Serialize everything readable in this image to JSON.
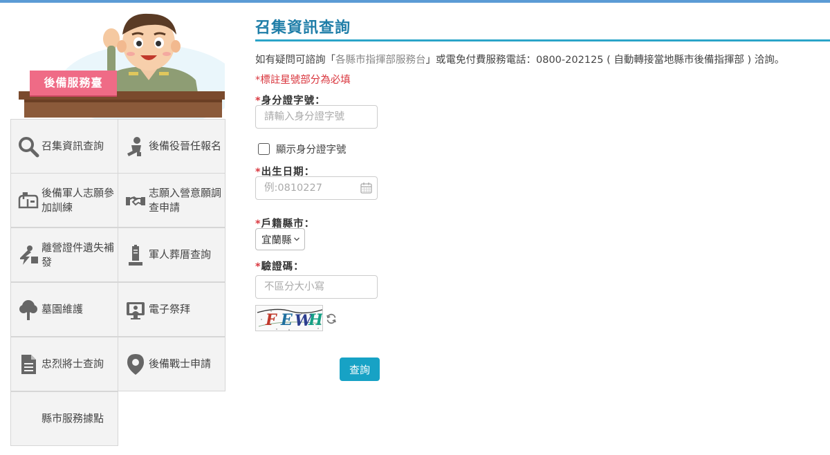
{
  "header": {
    "accent_color": "#5b9bd5"
  },
  "sidebar": {
    "sign_text": "後備服務臺",
    "items": [
      {
        "label": "召集資訊查詢",
        "icon": "search-icon"
      },
      {
        "label": "後備役晉任報名",
        "icon": "soldier-icon"
      },
      {
        "label": "後備軍人志願參加訓練",
        "icon": "mailbox-icon"
      },
      {
        "label": "志願入營意願調查申請",
        "icon": "handshake-icon"
      },
      {
        "label": "離營證件遺失補發",
        "icon": "broken-card-icon"
      },
      {
        "label": "軍人葬厝查詢",
        "icon": "tombstone-icon"
      },
      {
        "label": "墓園維護",
        "icon": "tree-icon"
      },
      {
        "label": "電子祭拜",
        "icon": "monitor-portrait-icon"
      },
      {
        "label": "忠烈將士查詢",
        "icon": "document-icon"
      },
      {
        "label": "後備戰士申請",
        "icon": "location-pin-icon"
      },
      {
        "label": "縣市服務據點",
        "icon": ""
      }
    ]
  },
  "main": {
    "title": "召集資訊查詢",
    "notice_prefix": "如有疑問可諮詢「",
    "notice_highlight": "各縣市指揮部服務台",
    "notice_suffix": "」或電免付費服務電話：0800-202125 ( 自動轉接當地縣市後備指揮部 ) 洽詢。",
    "required_note": "*標註星號部分為必填",
    "id_label": "身分證字號：",
    "id_placeholder": "請輸入身分證字號",
    "show_id_label": "顯示身分證字號",
    "birth_label": "出生日期：",
    "birth_placeholder": "例:0810227",
    "county_label": "戶籍縣市：",
    "county_value": "宜蘭縣",
    "captcha_label": "驗證碼：",
    "captcha_placeholder": "不區分大小寫",
    "captcha_text": "FEWH",
    "submit_label": "查詢",
    "star": "*",
    "colors": {
      "title": "#1f7ea8",
      "required": "#d9363e",
      "button": "#17a2c5"
    }
  }
}
